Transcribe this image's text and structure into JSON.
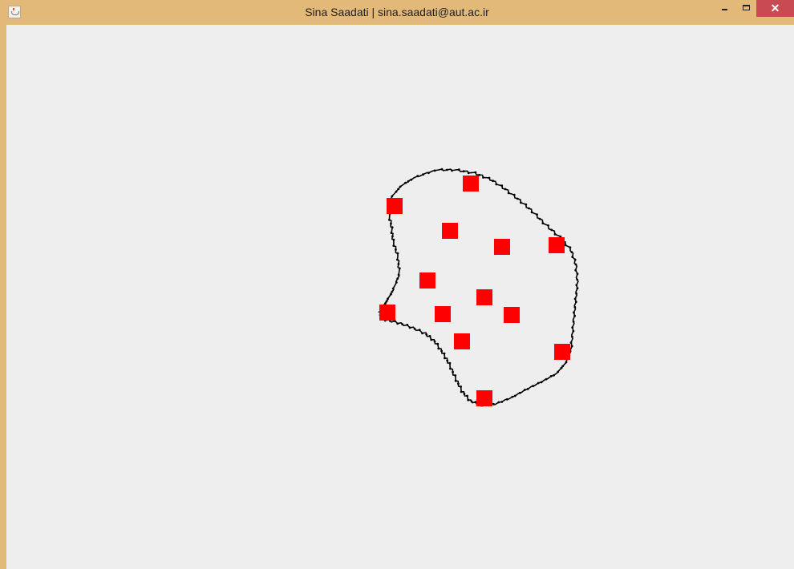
{
  "window": {
    "title": "Sina Saadati | sina.saadati@aut.ac.ir",
    "icon": "java-cup-icon",
    "controls": {
      "minimize_icon": "minimize-icon",
      "maximize_icon": "maximize-icon",
      "close_glyph": "✕"
    }
  },
  "canvas": {
    "background": "#eeeeee",
    "point_color": "#ff0000",
    "hull_color": "#000000",
    "point_count": 13
  }
}
